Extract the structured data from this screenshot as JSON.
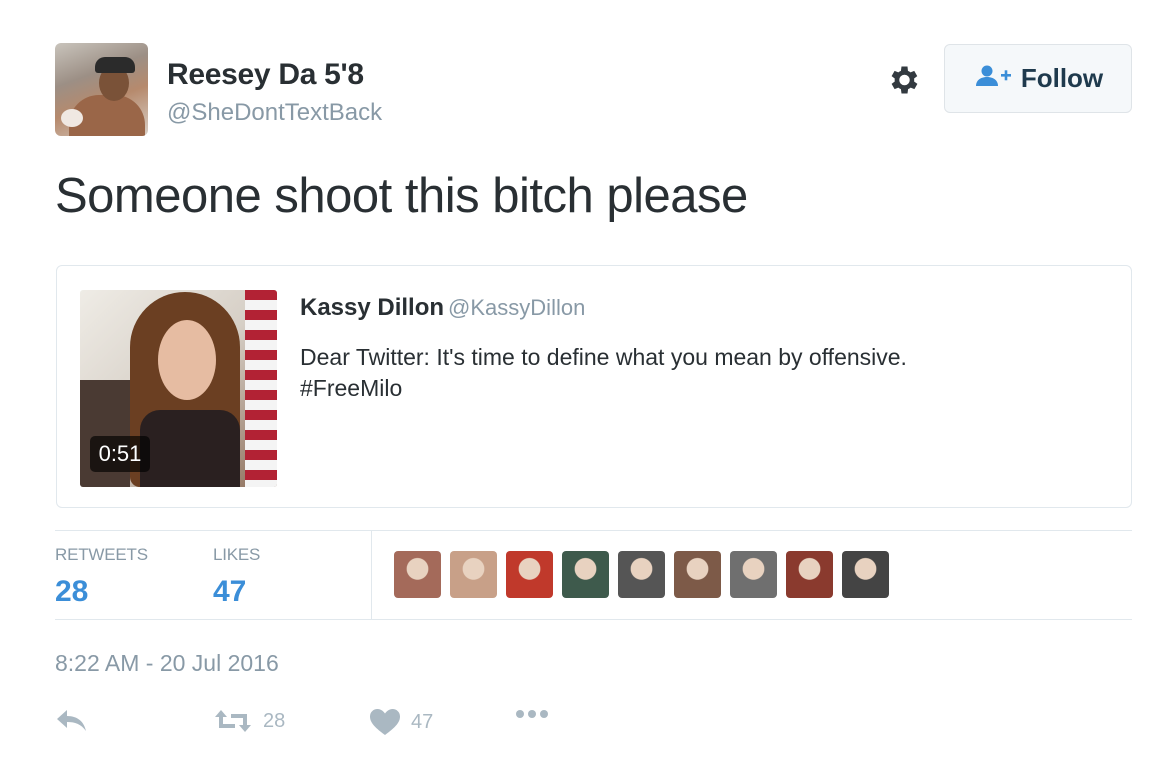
{
  "user": {
    "display_name": "Reesey Da 5'8",
    "handle": "@SheDontTextBack",
    "avatar_icon": "user-avatar"
  },
  "header": {
    "gear_icon": "gear-icon",
    "follow_label": "Follow",
    "follow_icon": "add-user-icon"
  },
  "tweet": {
    "text": "Someone shoot this bitch please",
    "timestamp": "8:22 AM - 20 Jul 2016"
  },
  "quoted": {
    "name": "Kassy Dillon",
    "handle": "@KassyDillon",
    "text_line1": "Dear Twitter: It's time to define what you mean by offensive.",
    "text_line2": "#FreeMilo",
    "video_duration": "0:51"
  },
  "stats": {
    "retweets_label": "RETWEETS",
    "retweets_value": "28",
    "likes_label": "LIKES",
    "likes_value": "47"
  },
  "likers": [
    {
      "color": "#a46a5a"
    },
    {
      "color": "#c8a088"
    },
    {
      "color": "#c0392b"
    },
    {
      "color": "#3e5a4c"
    },
    {
      "color": "#555555"
    },
    {
      "color": "#7d5a48"
    },
    {
      "color": "#6f6f6f"
    },
    {
      "color": "#8a3a2e"
    },
    {
      "color": "#444444"
    }
  ],
  "actions": {
    "reply_icon": "reply-icon",
    "retweet_icon": "retweet-icon",
    "retweet_count": "28",
    "like_icon": "heart-icon",
    "like_count": "47",
    "more_icon": "more-icon"
  },
  "colors": {
    "link_blue": "#3b8ed8",
    "muted_gray": "#8899a6",
    "text_dark": "#292f33"
  }
}
